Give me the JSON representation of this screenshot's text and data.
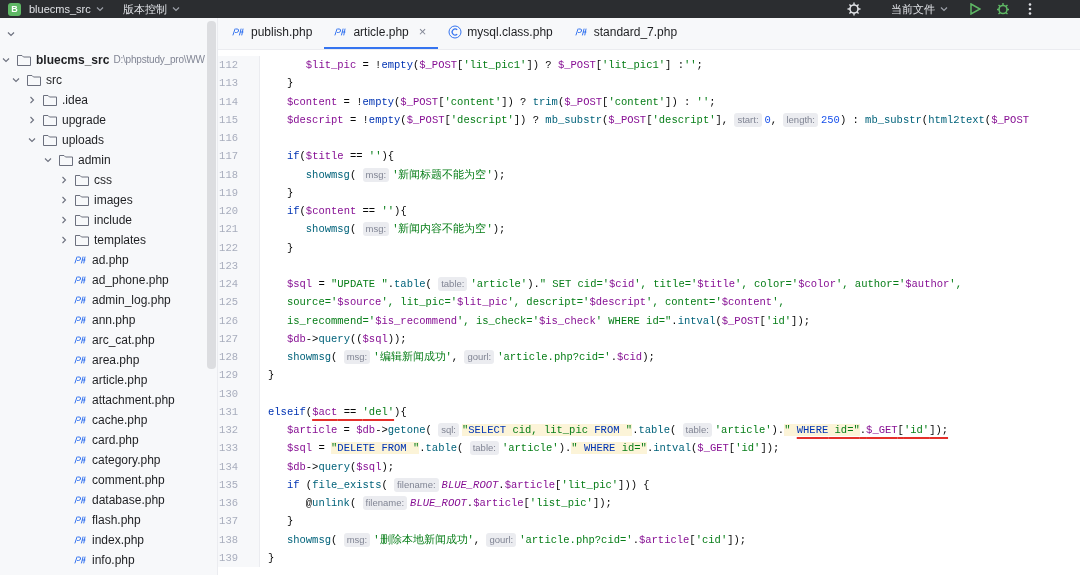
{
  "title_bar": {
    "project_badge": "B",
    "project": "bluecms_src",
    "vcs": "版本控制",
    "run_config": "当前文件"
  },
  "tabs": [
    {
      "label": "publish.php",
      "kind": "php",
      "selected": false
    },
    {
      "label": "article.php",
      "kind": "php",
      "selected": true,
      "close_glyph": "×"
    },
    {
      "label": "mysql.class.php",
      "kind": "class",
      "selected": false
    },
    {
      "label": "standard_7.php",
      "kind": "php",
      "selected": false
    }
  ],
  "project_tree": [
    {
      "label": "bluecms_src",
      "path": "D:\\phpstudy_pro\\WW",
      "kind": "project",
      "expanded": true,
      "children": [
        {
          "label": "src",
          "kind": "folder",
          "expanded": true,
          "children": [
            {
              "label": ".idea",
              "kind": "folder",
              "expanded": false
            },
            {
              "label": "upgrade",
              "kind": "folder",
              "expanded": false
            },
            {
              "label": "uploads",
              "kind": "folder",
              "expanded": true,
              "children": [
                {
                  "label": "admin",
                  "kind": "folder",
                  "expanded": true,
                  "children": [
                    {
                      "label": "css",
                      "kind": "folder",
                      "expanded": false
                    },
                    {
                      "label": "images",
                      "kind": "folder",
                      "expanded": false
                    },
                    {
                      "label": "include",
                      "kind": "folder",
                      "expanded": false
                    },
                    {
                      "label": "templates",
                      "kind": "folder",
                      "expanded": false
                    },
                    {
                      "label": "ad.php",
                      "kind": "file"
                    },
                    {
                      "label": "ad_phone.php",
                      "kind": "file"
                    },
                    {
                      "label": "admin_log.php",
                      "kind": "file"
                    },
                    {
                      "label": "ann.php",
                      "kind": "file"
                    },
                    {
                      "label": "arc_cat.php",
                      "kind": "file"
                    },
                    {
                      "label": "area.php",
                      "kind": "file"
                    },
                    {
                      "label": "article.php",
                      "kind": "file"
                    },
                    {
                      "label": "attachment.php",
                      "kind": "file"
                    },
                    {
                      "label": "cache.php",
                      "kind": "file"
                    },
                    {
                      "label": "card.php",
                      "kind": "file"
                    },
                    {
                      "label": "category.php",
                      "kind": "file"
                    },
                    {
                      "label": "comment.php",
                      "kind": "file"
                    },
                    {
                      "label": "database.php",
                      "kind": "file"
                    },
                    {
                      "label": "flash.php",
                      "kind": "file"
                    },
                    {
                      "label": "index.php",
                      "kind": "file"
                    },
                    {
                      "label": "info.php",
                      "kind": "file"
                    }
                  ]
                }
              ]
            }
          ]
        }
      ]
    }
  ],
  "code_lines": [
    {
      "number": "112",
      "parts": [
        {
          "kind": "code",
          "tokens": [
            {
              "kind": "var",
              "text": "      $lit_pic"
            },
            {
              "kind": "plain",
              "text": " = !"
            },
            {
              "kind": "kw",
              "text": "empty"
            },
            {
              "kind": "plain",
              "text": "("
            },
            {
              "kind": "var",
              "text": "$_POST"
            },
            {
              "kind": "plain",
              "text": "["
            },
            {
              "kind": "str",
              "text": "'lit_pic1'"
            },
            {
              "kind": "plain",
              "text": "]) ? "
            },
            {
              "kind": "var",
              "text": "$_POST"
            },
            {
              "kind": "plain",
              "text": "["
            },
            {
              "kind": "str",
              "text": "'lit_pic1'"
            },
            {
              "kind": "plain",
              "text": "] :"
            },
            {
              "kind": "str",
              "text": "''"
            },
            {
              "kind": "plain",
              "text": ";"
            }
          ]
        }
      ]
    },
    {
      "number": "113",
      "parts": [
        {
          "kind": "code",
          "tokens": [
            {
              "kind": "plain",
              "text": "   }"
            }
          ]
        }
      ]
    },
    {
      "number": "114",
      "parts": [
        {
          "kind": "code",
          "tokens": [
            {
              "kind": "var",
              "text": "   $content"
            },
            {
              "kind": "plain",
              "text": " = !"
            },
            {
              "kind": "kw",
              "text": "empty"
            },
            {
              "kind": "plain",
              "text": "("
            },
            {
              "kind": "var",
              "text": "$_POST"
            },
            {
              "kind": "plain",
              "text": "["
            },
            {
              "kind": "str",
              "text": "'content'"
            },
            {
              "kind": "plain",
              "text": "]) ? "
            },
            {
              "kind": "fn",
              "text": "trim"
            },
            {
              "kind": "plain",
              "text": "("
            },
            {
              "kind": "var",
              "text": "$_POST"
            },
            {
              "kind": "plain",
              "text": "["
            },
            {
              "kind": "str",
              "text": "'content'"
            },
            {
              "kind": "plain",
              "text": "]) : "
            },
            {
              "kind": "str",
              "text": "''"
            },
            {
              "kind": "plain",
              "text": ";"
            }
          ]
        }
      ]
    },
    {
      "number": "115",
      "parts": [
        {
          "kind": "code",
          "tokens": [
            {
              "kind": "var",
              "text": "   $descript"
            },
            {
              "kind": "plain",
              "text": " = !"
            },
            {
              "kind": "kw",
              "text": "empty"
            },
            {
              "kind": "plain",
              "text": "("
            },
            {
              "kind": "var",
              "text": "$_POST"
            },
            {
              "kind": "plain",
              "text": "["
            },
            {
              "kind": "str",
              "text": "'descript'"
            },
            {
              "kind": "plain",
              "text": "]) ? "
            },
            {
              "kind": "fn",
              "text": "mb_substr"
            },
            {
              "kind": "plain",
              "text": "("
            },
            {
              "kind": "var",
              "text": "$_POST"
            },
            {
              "kind": "plain",
              "text": "["
            },
            {
              "kind": "str",
              "text": "'descript'"
            },
            {
              "kind": "plain",
              "text": "], "
            }
          ]
        },
        {
          "kind": "hint",
          "text": "start:"
        },
        {
          "kind": "code",
          "tokens": [
            {
              "kind": "num",
              "text": "0"
            },
            {
              "kind": "plain",
              "text": ", "
            }
          ]
        },
        {
          "kind": "hint",
          "text": "length:"
        },
        {
          "kind": "code",
          "tokens": [
            {
              "kind": "num",
              "text": "250"
            },
            {
              "kind": "plain",
              "text": ") : "
            },
            {
              "kind": "fn",
              "text": "mb_substr"
            },
            {
              "kind": "plain",
              "text": "("
            },
            {
              "kind": "fn",
              "text": "html2text"
            },
            {
              "kind": "plain",
              "text": "("
            },
            {
              "kind": "var",
              "text": "$_POST"
            }
          ]
        }
      ]
    },
    {
      "number": "116"
    },
    {
      "number": "117",
      "parts": [
        {
          "kind": "code",
          "tokens": [
            {
              "kind": "kw",
              "text": "   if"
            },
            {
              "kind": "plain",
              "text": "("
            },
            {
              "kind": "var",
              "text": "$title"
            },
            {
              "kind": "plain",
              "text": " == "
            },
            {
              "kind": "str",
              "text": "''"
            },
            {
              "kind": "plain",
              "text": "){"
            }
          ]
        }
      ]
    },
    {
      "number": "118",
      "parts": [
        {
          "kind": "code",
          "tokens": [
            {
              "kind": "fn",
              "text": "      showmsg"
            },
            {
              "kind": "plain",
              "text": "( "
            }
          ]
        },
        {
          "kind": "hint",
          "text": "msg:"
        },
        {
          "kind": "code",
          "tokens": [
            {
              "kind": "str",
              "text": "'新闻标题不能为空'"
            },
            {
              "kind": "plain",
              "text": ");"
            }
          ]
        }
      ]
    },
    {
      "number": "119",
      "parts": [
        {
          "kind": "code",
          "tokens": [
            {
              "kind": "plain",
              "text": "   }"
            }
          ]
        }
      ]
    },
    {
      "number": "120",
      "parts": [
        {
          "kind": "code",
          "tokens": [
            {
              "kind": "kw",
              "text": "   if"
            },
            {
              "kind": "plain",
              "text": "("
            },
            {
              "kind": "var",
              "text": "$content"
            },
            {
              "kind": "plain",
              "text": " == "
            },
            {
              "kind": "str",
              "text": "''"
            },
            {
              "kind": "plain",
              "text": "){"
            }
          ]
        }
      ]
    },
    {
      "number": "121",
      "parts": [
        {
          "kind": "code",
          "tokens": [
            {
              "kind": "fn",
              "text": "      showmsg"
            },
            {
              "kind": "plain",
              "text": "( "
            }
          ]
        },
        {
          "kind": "hint",
          "text": "msg:"
        },
        {
          "kind": "code",
          "tokens": [
            {
              "kind": "str",
              "text": "'新闻内容不能为空'"
            },
            {
              "kind": "plain",
              "text": ");"
            }
          ]
        }
      ]
    },
    {
      "number": "122",
      "parts": [
        {
          "kind": "code",
          "tokens": [
            {
              "kind": "plain",
              "text": "   }"
            }
          ]
        }
      ]
    },
    {
      "number": "123"
    },
    {
      "number": "124",
      "parts": [
        {
          "kind": "code",
          "tokens": [
            {
              "kind": "var",
              "text": "   $sql"
            },
            {
              "kind": "plain",
              "text": " = "
            },
            {
              "kind": "str",
              "text": "\"UPDATE \""
            },
            {
              "kind": "plain",
              "text": "."
            },
            {
              "kind": "fn",
              "text": "table"
            },
            {
              "kind": "plain",
              "text": "( "
            }
          ]
        },
        {
          "kind": "hint",
          "text": "table:"
        },
        {
          "kind": "code",
          "tokens": [
            {
              "kind": "str",
              "text": "'article'"
            },
            {
              "kind": "plain",
              "text": ")."
            },
            {
              "kind": "str",
              "text": "\" SET cid='"
            },
            {
              "kind": "var",
              "text": "$cid"
            },
            {
              "kind": "str",
              "text": "', title='"
            },
            {
              "kind": "var",
              "text": "$title"
            },
            {
              "kind": "str",
              "text": "', color='"
            },
            {
              "kind": "var",
              "text": "$color"
            },
            {
              "kind": "str",
              "text": "', author='"
            },
            {
              "kind": "var",
              "text": "$author"
            },
            {
              "kind": "str",
              "text": "',"
            }
          ]
        }
      ]
    },
    {
      "number": "125",
      "parts": [
        {
          "kind": "code",
          "tokens": [
            {
              "kind": "str",
              "text": "   source='"
            },
            {
              "kind": "var",
              "text": "$source"
            },
            {
              "kind": "str",
              "text": "', lit_pic='"
            },
            {
              "kind": "var",
              "text": "$lit_pic"
            },
            {
              "kind": "str",
              "text": "', descript='"
            },
            {
              "kind": "var",
              "text": "$descript"
            },
            {
              "kind": "str",
              "text": "', content='"
            },
            {
              "kind": "var",
              "text": "$content"
            },
            {
              "kind": "str",
              "text": "',"
            }
          ]
        }
      ]
    },
    {
      "number": "126",
      "parts": [
        {
          "kind": "code",
          "tokens": [
            {
              "kind": "str",
              "text": "   is_recommend='"
            },
            {
              "kind": "var",
              "text": "$is_recommend"
            },
            {
              "kind": "str",
              "text": "', is_check='"
            },
            {
              "kind": "var",
              "text": "$is_check"
            },
            {
              "kind": "str",
              "text": "' WHERE id=\""
            },
            {
              "kind": "plain",
              "text": "."
            },
            {
              "kind": "fn",
              "text": "intval"
            },
            {
              "kind": "plain",
              "text": "("
            },
            {
              "kind": "var",
              "text": "$_POST"
            },
            {
              "kind": "plain",
              "text": "["
            },
            {
              "kind": "str",
              "text": "'id'"
            },
            {
              "kind": "plain",
              "text": "]);"
            }
          ]
        }
      ]
    },
    {
      "number": "127",
      "parts": [
        {
          "kind": "code",
          "tokens": [
            {
              "kind": "var",
              "text": "   $db"
            },
            {
              "kind": "plain",
              "text": "->"
            },
            {
              "kind": "fn",
              "text": "query"
            },
            {
              "kind": "plain",
              "text": "(("
            },
            {
              "kind": "var",
              "text": "$sql"
            },
            {
              "kind": "plain",
              "text": "));"
            }
          ]
        }
      ]
    },
    {
      "number": "128",
      "parts": [
        {
          "kind": "code",
          "tokens": [
            {
              "kind": "fn",
              "text": "   showmsg"
            },
            {
              "kind": "plain",
              "text": "( "
            }
          ]
        },
        {
          "kind": "hint",
          "text": "msg:"
        },
        {
          "kind": "code",
          "tokens": [
            {
              "kind": "str",
              "text": "'编辑新闻成功'"
            },
            {
              "kind": "plain",
              "text": ", "
            }
          ]
        },
        {
          "kind": "hint",
          "text": "gourl:"
        },
        {
          "kind": "code",
          "tokens": [
            {
              "kind": "str",
              "text": "'article.php?cid='"
            },
            {
              "kind": "plain",
              "text": "."
            },
            {
              "kind": "var",
              "text": "$cid"
            },
            {
              "kind": "plain",
              "text": ");"
            }
          ]
        }
      ]
    },
    {
      "number": "129",
      "parts": [
        {
          "kind": "code",
          "tokens": [
            {
              "kind": "plain",
              "text": "}"
            }
          ]
        }
      ]
    },
    {
      "number": "130"
    },
    {
      "number": "131",
      "parts": [
        {
          "kind": "code",
          "tokens": [
            {
              "kind": "kw",
              "text": "elseif"
            },
            {
              "kind": "plain",
              "text": "("
            }
          ]
        },
        {
          "kind": "marked",
          "tokens": [
            {
              "kind": "var",
              "text": "$act"
            },
            {
              "kind": "plain",
              "text": " == "
            },
            {
              "kind": "str",
              "text": "'del'"
            }
          ]
        },
        {
          "kind": "code",
          "tokens": [
            {
              "kind": "plain",
              "text": "){"
            }
          ]
        }
      ]
    },
    {
      "number": "132",
      "parts": [
        {
          "kind": "code",
          "tokens": [
            {
              "kind": "var",
              "text": "   $article"
            },
            {
              "kind": "plain",
              "text": " = "
            },
            {
              "kind": "var",
              "text": "$db"
            },
            {
              "kind": "plain",
              "text": "->"
            },
            {
              "kind": "fn",
              "text": "getone"
            },
            {
              "kind": "plain",
              "text": "( "
            }
          ]
        },
        {
          "kind": "hint",
          "text": "sql:"
        },
        {
          "kind": "code",
          "tokens": [
            {
              "kind": "sql_str",
              "text": "\""
            },
            {
              "kind": "sql_kw",
              "text": "SELECT"
            },
            {
              "kind": "sql_str",
              "text": " cid, lit_pic "
            },
            {
              "kind": "sql_kw",
              "text": "FROM"
            },
            {
              "kind": "sql_str",
              "text": " \""
            },
            {
              "kind": "plain",
              "text": "."
            },
            {
              "kind": "fn",
              "text": "table"
            },
            {
              "kind": "plain",
              "text": "( "
            }
          ]
        },
        {
          "kind": "hint",
          "text": "table:"
        },
        {
          "kind": "code",
          "tokens": [
            {
              "kind": "str",
              "text": "'article'"
            },
            {
              "kind": "plain",
              "text": ")."
            },
            {
              "kind": "sql_str",
              "text": "\" "
            }
          ]
        },
        {
          "kind": "marked",
          "tokens": [
            {
              "kind": "sql_kw",
              "text": "WHERE"
            },
            {
              "kind": "sql_str",
              "text": " id=\""
            },
            {
              "kind": "plain",
              "text": "."
            },
            {
              "kind": "var",
              "text": "$_GET"
            },
            {
              "kind": "plain",
              "text": "["
            },
            {
              "kind": "str",
              "text": "'id'"
            },
            {
              "kind": "plain",
              "text": "]);"
            }
          ]
        }
      ]
    },
    {
      "number": "133",
      "parts": [
        {
          "kind": "code",
          "tokens": [
            {
              "kind": "var",
              "text": "   $sql"
            },
            {
              "kind": "plain",
              "text": " = "
            },
            {
              "kind": "sql_str",
              "text": "\""
            },
            {
              "kind": "sql_kw",
              "text": "DELETE FROM"
            },
            {
              "kind": "sql_str",
              "text": " \""
            },
            {
              "kind": "plain",
              "text": "."
            },
            {
              "kind": "fn",
              "text": "table"
            },
            {
              "kind": "plain",
              "text": "( "
            }
          ]
        },
        {
          "kind": "hint",
          "text": "table:"
        },
        {
          "kind": "code",
          "tokens": [
            {
              "kind": "str",
              "text": "'article'"
            },
            {
              "kind": "plain",
              "text": ")."
            },
            {
              "kind": "sql_str",
              "text": "\" "
            },
            {
              "kind": "sql_kw",
              "text": "WHERE"
            },
            {
              "kind": "sql_str",
              "text": " id=\""
            },
            {
              "kind": "plain",
              "text": "."
            },
            {
              "kind": "fn",
              "text": "intval"
            },
            {
              "kind": "plain",
              "text": "("
            },
            {
              "kind": "var",
              "text": "$_GET"
            },
            {
              "kind": "plain",
              "text": "["
            },
            {
              "kind": "str",
              "text": "'id'"
            },
            {
              "kind": "plain",
              "text": "]);"
            }
          ]
        }
      ]
    },
    {
      "number": "134",
      "parts": [
        {
          "kind": "code",
          "tokens": [
            {
              "kind": "var",
              "text": "   $db"
            },
            {
              "kind": "plain",
              "text": "->"
            },
            {
              "kind": "fn",
              "text": "query"
            },
            {
              "kind": "plain",
              "text": "("
            },
            {
              "kind": "var",
              "text": "$sql"
            },
            {
              "kind": "plain",
              "text": ");"
            }
          ]
        }
      ]
    },
    {
      "number": "135",
      "parts": [
        {
          "kind": "code",
          "tokens": [
            {
              "kind": "kw",
              "text": "   if"
            },
            {
              "kind": "plain",
              "text": " ("
            },
            {
              "kind": "fn",
              "text": "file_exists"
            },
            {
              "kind": "plain",
              "text": "( "
            }
          ]
        },
        {
          "kind": "hint",
          "text": "filename:"
        },
        {
          "kind": "code",
          "tokens": [
            {
              "kind": "const",
              "text": "BLUE_ROOT"
            },
            {
              "kind": "plain",
              "text": "."
            },
            {
              "kind": "var",
              "text": "$article"
            },
            {
              "kind": "plain",
              "text": "["
            },
            {
              "kind": "str",
              "text": "'lit_pic'"
            },
            {
              "kind": "plain",
              "text": "])) {"
            }
          ]
        }
      ]
    },
    {
      "number": "136",
      "parts": [
        {
          "kind": "code",
          "tokens": [
            {
              "kind": "plain",
              "text": "      @"
            },
            {
              "kind": "fn",
              "text": "unlink"
            },
            {
              "kind": "plain",
              "text": "( "
            }
          ]
        },
        {
          "kind": "hint",
          "text": "filename:"
        },
        {
          "kind": "code",
          "tokens": [
            {
              "kind": "const",
              "text": "BLUE_ROOT"
            },
            {
              "kind": "plain",
              "text": "."
            },
            {
              "kind": "var",
              "text": "$article"
            },
            {
              "kind": "plain",
              "text": "["
            },
            {
              "kind": "str",
              "text": "'list_pic'"
            },
            {
              "kind": "plain",
              "text": "]);"
            }
          ]
        }
      ]
    },
    {
      "number": "137",
      "parts": [
        {
          "kind": "code",
          "tokens": [
            {
              "kind": "plain",
              "text": "   }"
            }
          ]
        }
      ]
    },
    {
      "number": "138",
      "parts": [
        {
          "kind": "code",
          "tokens": [
            {
              "kind": "fn",
              "text": "   showmsg"
            },
            {
              "kind": "plain",
              "text": "( "
            }
          ]
        },
        {
          "kind": "hint",
          "text": "msg:"
        },
        {
          "kind": "code",
          "tokens": [
            {
              "kind": "str",
              "text": "'删除本地新闻成功'"
            },
            {
              "kind": "plain",
              "text": ", "
            }
          ]
        },
        {
          "kind": "hint",
          "text": "gourl:"
        },
        {
          "kind": "code",
          "tokens": [
            {
              "kind": "str",
              "text": "'article.php?cid='"
            },
            {
              "kind": "plain",
              "text": "."
            },
            {
              "kind": "var",
              "text": "$article"
            },
            {
              "kind": "plain",
              "text": "["
            },
            {
              "kind": "str",
              "text": "'cid'"
            },
            {
              "kind": "plain",
              "text": "]);"
            }
          ]
        }
      ]
    },
    {
      "number": "139",
      "parts": [
        {
          "kind": "code",
          "tokens": [
            {
              "kind": "plain",
              "text": "}"
            }
          ]
        }
      ]
    }
  ]
}
